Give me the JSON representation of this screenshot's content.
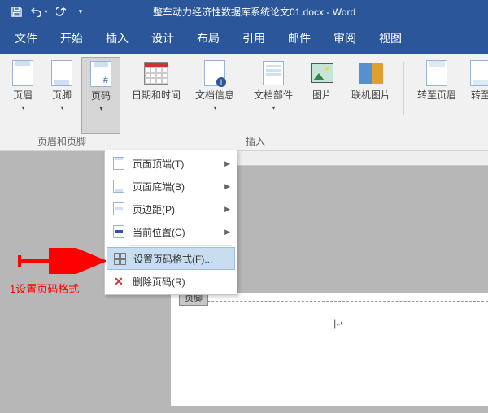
{
  "titlebar": {
    "doc_title": "整车动力经济性数据库系统论文01.docx - Word"
  },
  "menubar": {
    "tabs": [
      "文件",
      "开始",
      "插入",
      "设计",
      "布局",
      "引用",
      "邮件",
      "审阅",
      "视图"
    ]
  },
  "ribbon": {
    "group1_label": "页眉和页脚",
    "group2_label": "插入",
    "buttons": {
      "header": "页眉",
      "footer": "页脚",
      "pagenum": "页码",
      "datetime": "日期和时间",
      "docinfo": "文档信息",
      "docparts": "文档部件",
      "picture": "图片",
      "online_picture": "联机图片",
      "goto_header": "转至页眉",
      "goto_footer": "转至"
    }
  },
  "dropdown": {
    "items": [
      {
        "label": "页面顶端(T)",
        "arrow": true
      },
      {
        "label": "页面底端(B)",
        "arrow": true
      },
      {
        "label": "页边距(P)",
        "arrow": true
      },
      {
        "label": "当前位置(C)",
        "arrow": true
      }
    ],
    "format_label": "设置页码格式(F)...",
    "remove_label": "删除页码(R)"
  },
  "document": {
    "footer_tab": "页脚"
  },
  "annotation": {
    "text": "1设置页码格式"
  }
}
